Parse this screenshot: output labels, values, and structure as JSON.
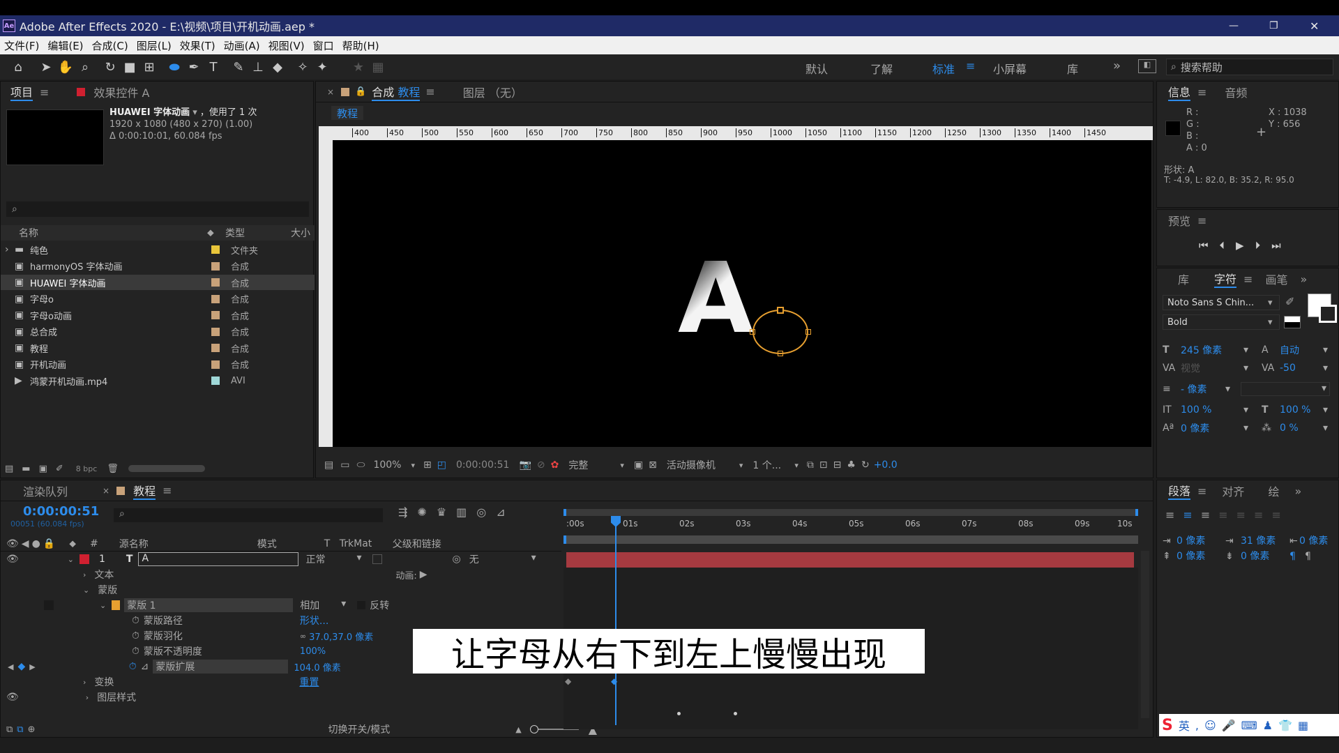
{
  "window": {
    "title": "Adobe After Effects 2020 - E:\\视频\\项目\\开机动画.aep *",
    "app_icon": "Ae",
    "minimize": "—",
    "restore": "❐",
    "close": "✕"
  },
  "menu": [
    "文件(F)",
    "编辑(E)",
    "合成(C)",
    "图层(L)",
    "效果(T)",
    "动画(A)",
    "视图(V)",
    "窗口",
    "帮助(H)"
  ],
  "workspaces": [
    "默认",
    "了解",
    "标准",
    "小屏幕",
    "库"
  ],
  "workspace_more": "»",
  "search_help": {
    "placeholder": "搜索帮助"
  },
  "project": {
    "tab": "项目",
    "effects_tab": "效果控件 A",
    "item_name": "HUAWEI 字体动画",
    "used": "，使用了 1 次",
    "info1": "1920 x 1080 (480 x 270) (1.00)",
    "info2": "Δ 0:00:10:01, 60.084 fps",
    "col_name": "名称",
    "col_type": "类型",
    "col_size": "大小",
    "items": [
      {
        "name": "纯色",
        "type": "文件夹",
        "color": "#e8c53a",
        "icon": "folder-icon",
        "chev": "›"
      },
      {
        "name": "harmonyOS 字体动画",
        "type": "合成",
        "color": "#c8a27a",
        "icon": "comp-icon",
        "chev": ""
      },
      {
        "name": "HUAWEI 字体动画",
        "type": "合成",
        "color": "#c8a27a",
        "icon": "comp-icon",
        "chev": ""
      },
      {
        "name": "字母o",
        "type": "合成",
        "color": "#c8a27a",
        "icon": "comp-icon",
        "chev": ""
      },
      {
        "name": "字母o动画",
        "type": "合成",
        "color": "#c8a27a",
        "icon": "comp-icon",
        "chev": ""
      },
      {
        "name": "总合成",
        "type": "合成",
        "color": "#c8a27a",
        "icon": "comp-icon",
        "chev": ""
      },
      {
        "name": "教程",
        "type": "合成",
        "color": "#c8a27a",
        "icon": "comp-icon",
        "chev": ""
      },
      {
        "name": "开机动画",
        "type": "合成",
        "color": "#c8a27a",
        "icon": "comp-icon",
        "chev": ""
      },
      {
        "name": "鸿蒙开机动画.mp4",
        "type": "AVI",
        "color": "#9fd8d8",
        "icon": "video-icon",
        "chev": ""
      }
    ],
    "bpc": "8 bpc"
  },
  "comp": {
    "tab_prefix": "合成",
    "tab_name": "教程",
    "layer_tab": "图层 （无）",
    "subtab": "教程",
    "ruler": [
      "400",
      "450",
      "500",
      "550",
      "600",
      "650",
      "700",
      "750",
      "800",
      "850",
      "900",
      "950",
      "1000",
      "1050",
      "1100",
      "1150",
      "1200",
      "1250",
      "1300",
      "1350",
      "1400",
      "1450"
    ],
    "letter": "A",
    "zoom": "100%",
    "timecode": "0:00:00:51",
    "quality": "完整",
    "camera": "活动摄像机",
    "views": "1 个...",
    "exposure": "+0.0"
  },
  "info": {
    "tab": "信息",
    "audio_tab": "音频",
    "r": "R :",
    "g": "G :",
    "b": "B :",
    "a": "A : 0",
    "x": "X : 1038",
    "y": "Y : 656",
    "shape": "形状: A",
    "coords": "T: -4.9,  L: 82.0,  B: 35.2,  R: 95.0"
  },
  "preview": {
    "tab": "预览"
  },
  "character": {
    "lib_tab": "库",
    "tab": "字符",
    "paint_tab": "画笔",
    "font": "Noto Sans S Chin...",
    "style": "Bold",
    "size": "245 像素",
    "leading": "自动",
    "kerning": "视觉",
    "tracking": "-50",
    "stroke": "- 像素",
    "vscale": "100 %",
    "hscale": "100 %",
    "baseline": "0 像素",
    "tsume": "0 %"
  },
  "paragraph": {
    "tab": "段落",
    "align_tab": "对齐",
    "draw_tab": "绘",
    "indent_left": "0 像素",
    "indent_right": "0 像素",
    "first_line": "31 像素",
    "space_before": "0 像素",
    "space_after": "0 像素"
  },
  "timeline": {
    "render_tab": "渲染队列",
    "tab": "教程",
    "timecode": "0:00:00:51",
    "frames": "00051 (60.084 fps)",
    "col_source": "源名称",
    "col_mode": "模式",
    "col_t": "T",
    "col_trkmat": "TrkMat",
    "col_parent": "父级和链接",
    "col_num": "#",
    "layer_num": "1",
    "layer_name": "A",
    "layer_mode": "正常",
    "layer_parent": "无",
    "text": "文本",
    "animate": "动画:",
    "masks": "蒙版",
    "mask1": "蒙版 1",
    "mask_mode": "相加",
    "invert": "反转",
    "mask_path": "蒙版路径",
    "mask_path_val": "形状...",
    "feather": "蒙版羽化",
    "feather_val": "37.0,37.0 像素",
    "opacity": "蒙版不透明度",
    "opacity_val": "100%",
    "expansion": "蒙版扩展",
    "expansion_val": "104.0 像素",
    "transform": "变换",
    "reset": "重置",
    "layer_styles": "图层样式",
    "toggle": "切换开关/模式",
    "ticks": [
      ":00s",
      "01s",
      "02s",
      "03s",
      "04s",
      "05s",
      "06s",
      "07s",
      "08s",
      "09s",
      "10s"
    ]
  },
  "subtitle": "让字母从右下到左上慢慢出现",
  "ime": {
    "lang": "英"
  }
}
